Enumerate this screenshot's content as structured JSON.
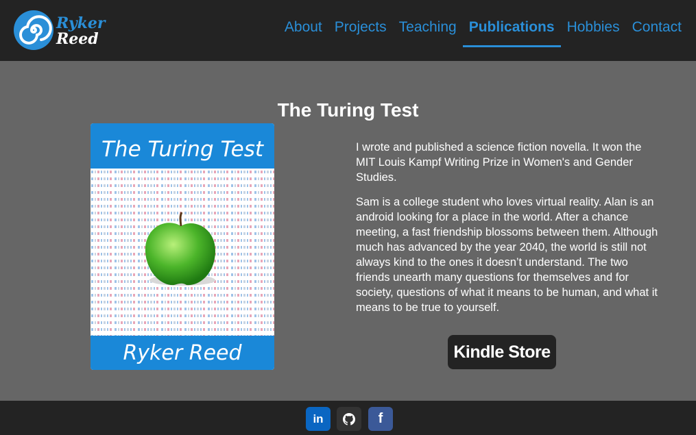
{
  "brand": {
    "line1": "Ryker",
    "line2": "Reed"
  },
  "nav": [
    {
      "label": "About"
    },
    {
      "label": "Projects"
    },
    {
      "label": "Teaching"
    },
    {
      "label": "Publications",
      "active": true
    },
    {
      "label": "Hobbies"
    },
    {
      "label": "Contact"
    }
  ],
  "page": {
    "title": "The Turing Test"
  },
  "cover": {
    "title": "The Turing Test",
    "author": "Ryker Reed"
  },
  "description": {
    "p1": "I wrote and published a science fiction novella. It won the MIT Louis Kampf Writing Prize in Women's and Gender Studies.",
    "p2": "Sam is a college student who loves virtual reality. Alan is an android looking for a place in the world. After a chance meeting, a fast friendship blossoms between them. Although much has advanced by the year 2040, the world is still not always kind to the ones it doesn’t understand. The two friends unearth many questions for themselves and for society, questions of what it means to be human, and what it means to be true to yourself."
  },
  "kindle_button": "Kindle Store",
  "social": [
    {
      "icon": "linkedin-icon",
      "label": "in",
      "color": "#0a66c2"
    },
    {
      "icon": "github-icon",
      "color": "#333333"
    },
    {
      "icon": "facebook-icon",
      "label": "f",
      "color": "#3b5998"
    }
  ],
  "colors": {
    "accent": "#2a8fd8",
    "header": "#232323",
    "background": "#666666"
  }
}
